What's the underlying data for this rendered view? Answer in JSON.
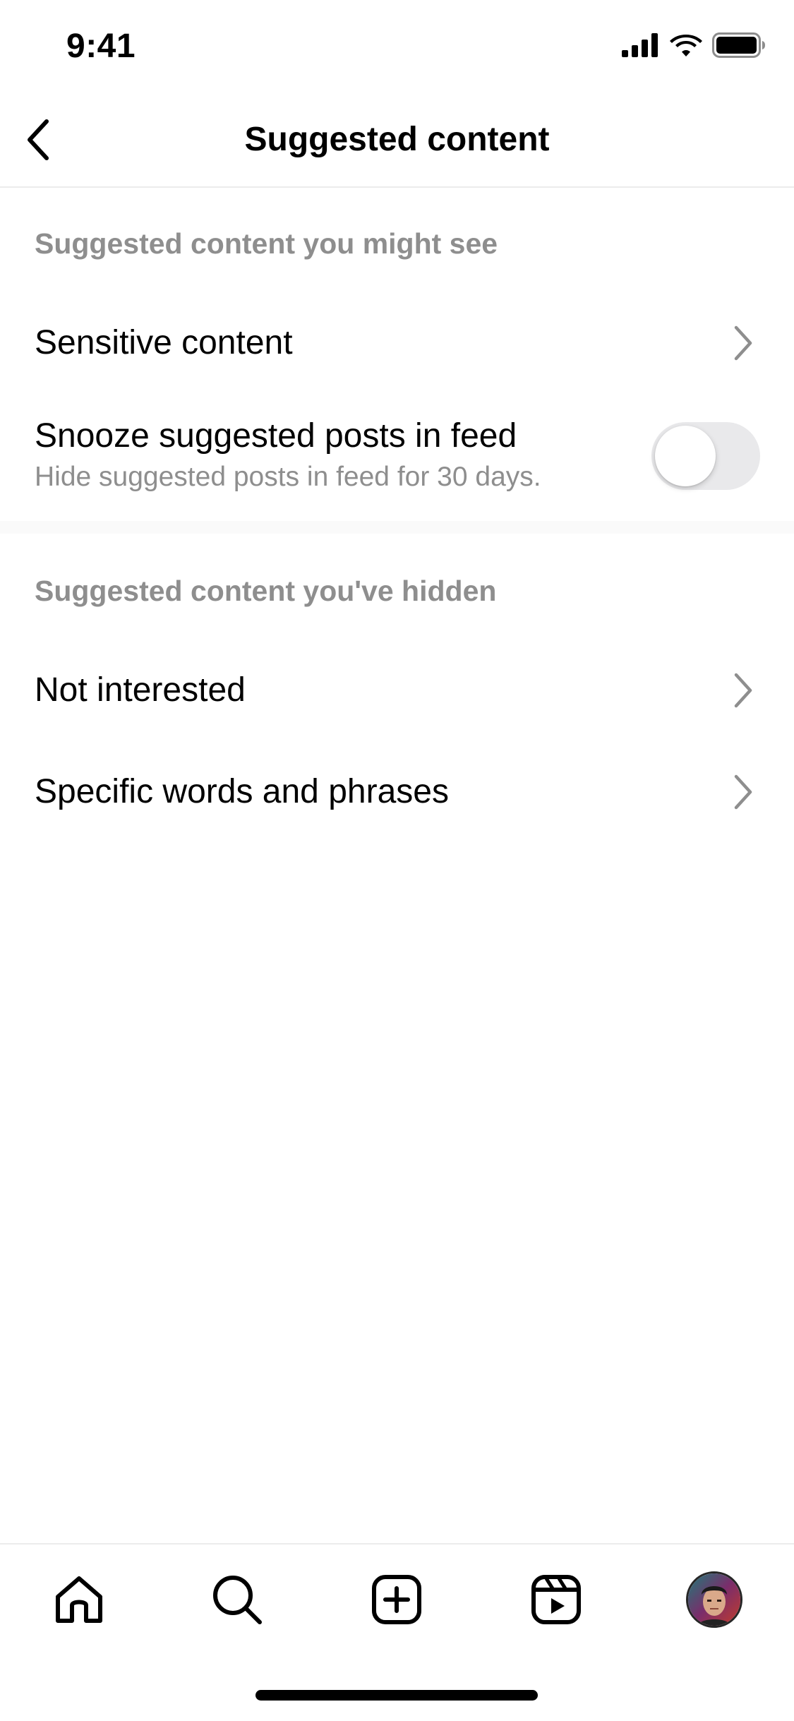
{
  "status_bar": {
    "time": "9:41",
    "icons": [
      "cellular-signal-icon",
      "wifi-icon",
      "battery-icon"
    ]
  },
  "header": {
    "back_icon": "chevron-left-icon",
    "title": "Suggested content"
  },
  "section_might_see": {
    "heading": "Suggested content you might see",
    "items": [
      {
        "label": "Sensitive content",
        "icon": "chevron-right-icon"
      },
      {
        "label": "Snooze suggested posts in feed",
        "sublabel": "Hide suggested posts in feed for 30 days.",
        "toggle_on": false
      }
    ]
  },
  "section_hidden": {
    "heading": "Suggested content you've hidden",
    "items": [
      {
        "label": "Not interested",
        "icon": "chevron-right-icon"
      },
      {
        "label": "Specific words and phrases",
        "icon": "chevron-right-icon"
      }
    ]
  },
  "bottom_nav": {
    "items": [
      "home-icon",
      "search-icon",
      "create-post-icon",
      "reels-icon",
      "profile-avatar"
    ]
  },
  "colors": {
    "text_primary": "#000000",
    "text_secondary": "#8e8e8e",
    "divider": "#ececec",
    "toggle_off": "#e9e9eb"
  }
}
